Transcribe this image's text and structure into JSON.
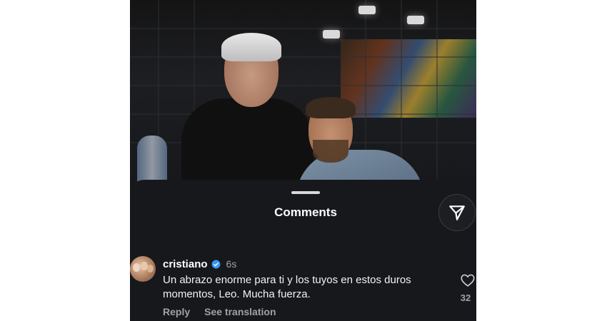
{
  "sheet": {
    "title": "Comments"
  },
  "comment": {
    "username": "cristiano",
    "verified": true,
    "time": "6s",
    "text": "Un abrazo enorme para ti y los tuyos en estos duros momentos, Leo. Mucha fuerza.",
    "reply_label": "Reply",
    "translate_label": "See translation",
    "like_count": "32"
  },
  "icons": {
    "share": "paper-plane-icon",
    "verified": "verified-badge-icon",
    "like": "heart-outline-icon"
  },
  "colors": {
    "background": "#16181c",
    "verified": "#3897f0"
  }
}
